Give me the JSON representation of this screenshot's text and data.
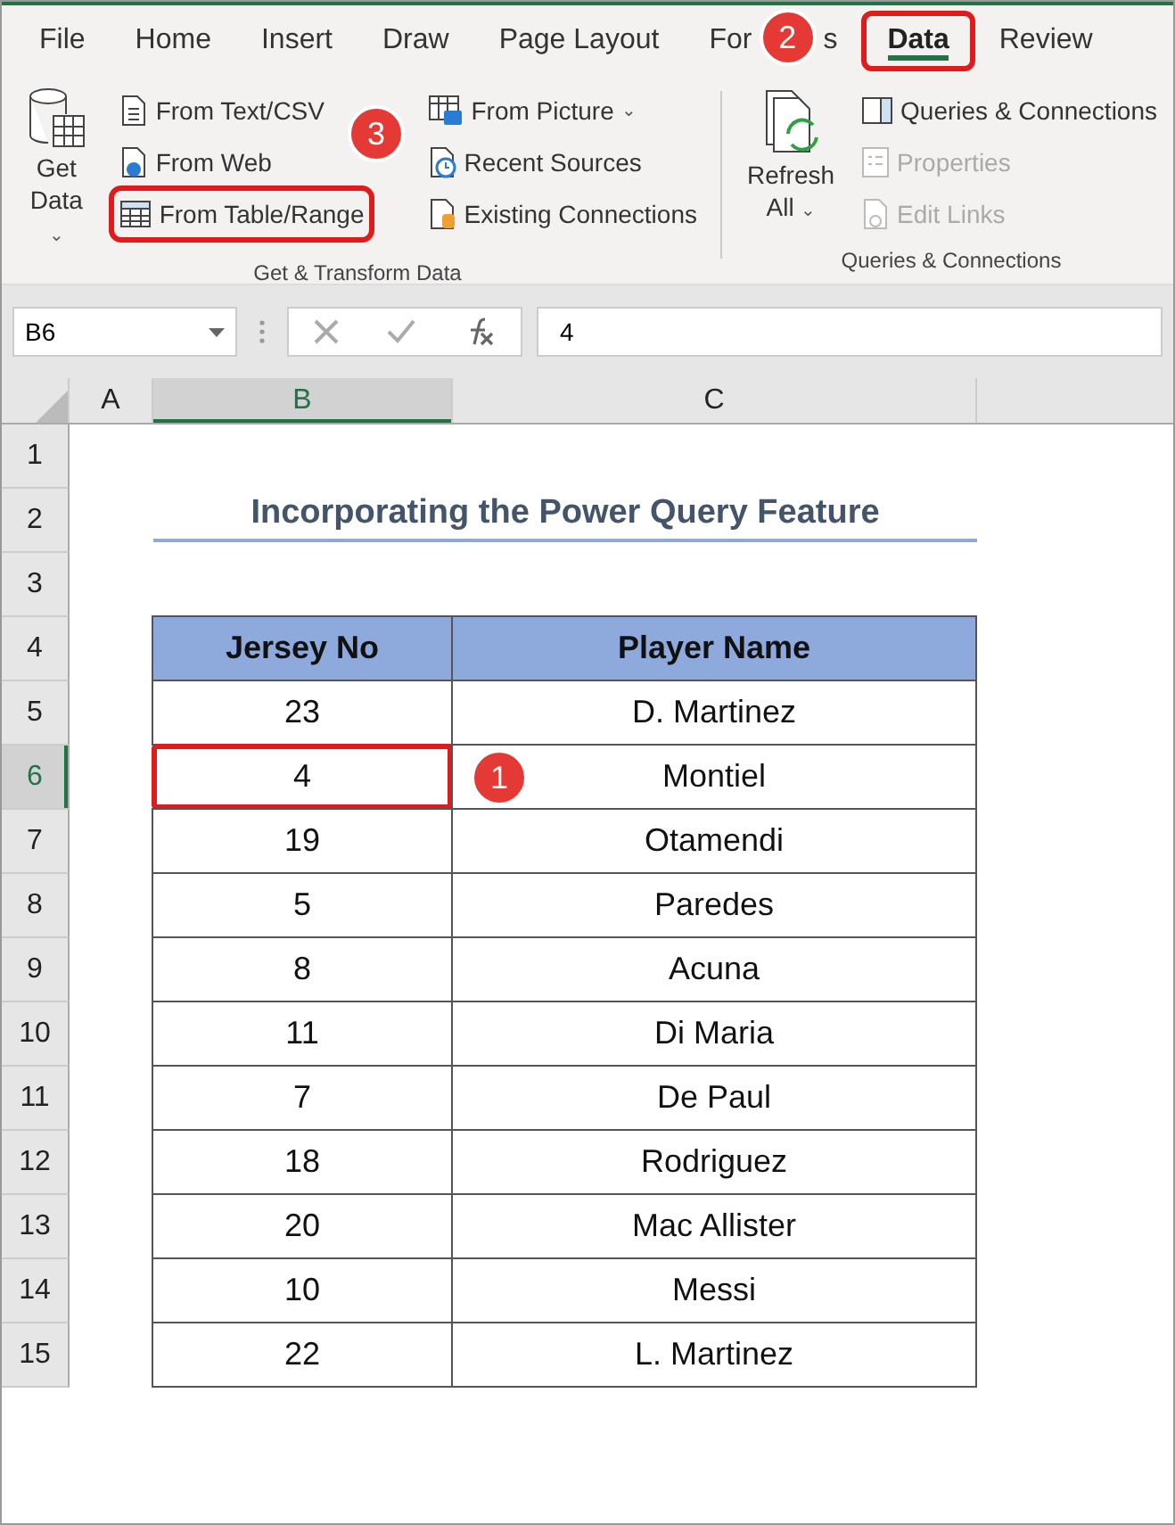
{
  "tabs": [
    {
      "label": "File",
      "selected": false
    },
    {
      "label": "Home",
      "selected": false
    },
    {
      "label": "Insert",
      "selected": false
    },
    {
      "label": "Draw",
      "selected": false
    },
    {
      "label": "Page Layout",
      "selected": false
    },
    {
      "label": "For",
      "tail": "s",
      "selected": false
    },
    {
      "label": "Data",
      "selected": true
    },
    {
      "label": "Review",
      "selected": false
    }
  ],
  "ribbon": {
    "groups": [
      {
        "label": "Get & Transform Data",
        "large": {
          "label": "Get",
          "label2": "Data",
          "caret": "⌄"
        },
        "columns": [
          [
            {
              "label": "From Text/CSV",
              "disabled": false,
              "highlighted": false
            },
            {
              "label": "From Web",
              "disabled": false,
              "highlighted": false
            },
            {
              "label": "From Table/Range",
              "disabled": false,
              "highlighted": true
            }
          ],
          [
            {
              "label": "From Picture",
              "caret": "⌄",
              "disabled": false,
              "highlighted": false
            },
            {
              "label": "Recent Sources",
              "disabled": false,
              "highlighted": false
            },
            {
              "label": "Existing Connections",
              "disabled": false,
              "highlighted": false
            }
          ]
        ]
      },
      {
        "label": "Queries & Connections",
        "large": {
          "label": "Refresh",
          "label2": "All",
          "caret": "⌄"
        },
        "columns": [
          [
            {
              "label": "Queries & Connections",
              "disabled": false,
              "highlighted": false
            },
            {
              "label": "Properties",
              "disabled": true,
              "highlighted": false
            },
            {
              "label": "Edit Links",
              "disabled": true,
              "highlighted": false
            }
          ]
        ]
      }
    ]
  },
  "formula_bar": {
    "name_box": "B6",
    "value": "4"
  },
  "columns": [
    {
      "label": "A",
      "selected": false
    },
    {
      "label": "B",
      "selected": true
    },
    {
      "label": "C",
      "selected": false
    }
  ],
  "row_numbers": [
    "1",
    "2",
    "3",
    "4",
    "5",
    "6",
    "7",
    "8",
    "9",
    "10",
    "11",
    "12",
    "13",
    "14",
    "15"
  ],
  "title": "Incorporating the Power Query Feature",
  "table": {
    "headers": [
      "Jersey No",
      "Player Name"
    ],
    "rows": [
      {
        "jersey": "23",
        "name": "D. Martinez",
        "selected": false
      },
      {
        "jersey": "4",
        "name": "Montiel",
        "selected": true
      },
      {
        "jersey": "19",
        "name": "Otamendi",
        "selected": false
      },
      {
        "jersey": "5",
        "name": "Paredes",
        "selected": false
      },
      {
        "jersey": "8",
        "name": "Acuna",
        "selected": false
      },
      {
        "jersey": "11",
        "name": "Di Maria",
        "selected": false
      },
      {
        "jersey": "7",
        "name": "De Paul",
        "selected": false
      },
      {
        "jersey": "18",
        "name": "Rodriguez",
        "selected": false
      },
      {
        "jersey": "20",
        "name": "Mac Allister",
        "selected": false
      },
      {
        "jersey": "10",
        "name": "Messi",
        "selected": false
      },
      {
        "jersey": "22",
        "name": "L. Martinez",
        "selected": false
      }
    ]
  },
  "callouts": [
    {
      "label": "1"
    },
    {
      "label": "2"
    },
    {
      "label": "3"
    }
  ]
}
